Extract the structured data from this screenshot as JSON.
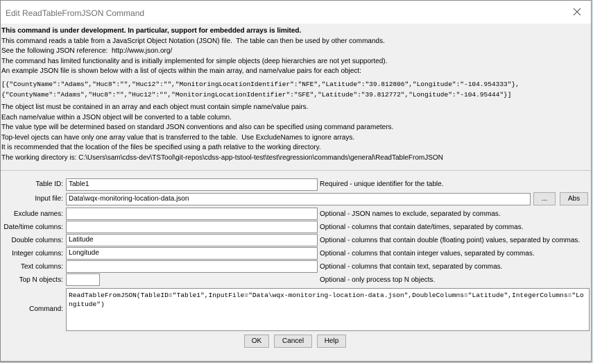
{
  "window": {
    "title": "Edit ReadTableFromJSON Command"
  },
  "info": {
    "lines": [
      "This command is under development. In particular, support for embedded arrays is limited.",
      "This command reads a table from a JavaScript Object Notation (JSON) file.  The table can then be used by other commands.",
      "See the following JSON reference:  http://www.json.org/",
      "The command has limited functionality and is initially implemented for simple objects (deep hierarchies are not yet supported).",
      "An example JSON file is shown below with a list of ojects within the main array, and name/value pairs for each object:"
    ],
    "code": [
      "[{\"CountyName\":\"Adams\",\"Huc8\":\"\",\"Huc12\":\"\",\"MonitoringLocationIdentifier\":\"NFE\",\"Latitude\":\"39.812806\",\"Longitude\":\"-104.954333\"},",
      "{\"CountyName\":\"Adams\",\"Huc8\":\"\",\"Huc12\":\"\",\"MonitoringLocationIdentifier\":\"SFE\",\"Latitude\":\"39.812772\",\"Longitude\":\"-104.95444\"}]"
    ],
    "notes": [
      "The object list must be contained in an array and each object must contain simple name/value pairs.",
      "Each name/value within a JSON object will be converted to a table column.",
      "The value type will be determined based on standard JSON conventions and also can be specified using command parameters.",
      "Top-level ojects can have only one array value that is transferred to the table.  Use ExcludeNames to ignore arrays.",
      "It is recommended that the location of the files be specified using a path relative to the working directory.",
      "The working directory is: C:\\Users\\sam\\cdss-dev\\TSTool\\git-repos\\cdss-app-tstool-test\\test\\regression\\commands\\general\\ReadTableFromJSON"
    ]
  },
  "form": {
    "table_id": {
      "label": "Table ID:",
      "value": "Table1",
      "desc": "Required - unique identifier for the table."
    },
    "input_file": {
      "label": "Input file:",
      "value": "Data\\wqx-monitoring-location-data.json",
      "browse": "...",
      "abs": "Abs"
    },
    "exclude_names": {
      "label": "Exclude names:",
      "value": "",
      "desc": "Optional - JSON names to exclude, separated by commas."
    },
    "datetime_columns": {
      "label": "Date/time columns:",
      "value": "",
      "desc": "Optional - columns that contain date/times, separated by commas."
    },
    "double_columns": {
      "label": "Double columns:",
      "value": "Latitude",
      "desc": "Optional - columns that contain double (floating point) values, separated by commas."
    },
    "integer_columns": {
      "label": "Integer columns:",
      "value": "Longitude",
      "desc": "Optional - columns that contain integer values, separated by commas."
    },
    "text_columns": {
      "label": "Text columns:",
      "value": "",
      "desc": "Optional - columns that contain text, separated by commas."
    },
    "top_n": {
      "label": "Top N objects:",
      "value": "",
      "desc": "Optional - only process top N objects."
    },
    "command": {
      "label": "Command:",
      "value": "ReadTableFromJSON(TableID=\"Table1\",InputFile=\"Data\\wqx-monitoring-location-data.json\",DoubleColumns=\"Latitude\",IntegerColumns=\"Longitude\")"
    }
  },
  "buttons": {
    "ok": "OK",
    "cancel": "Cancel",
    "help": "Help"
  }
}
